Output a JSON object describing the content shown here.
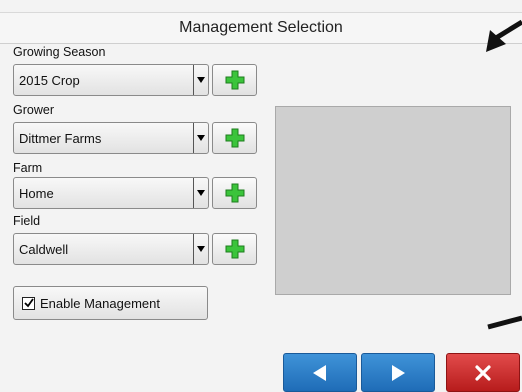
{
  "header": {
    "title": "Management Selection"
  },
  "fields": [
    {
      "label": "Growing Season",
      "value": "2015 Crop"
    },
    {
      "label": "Grower",
      "value": "Dittmer Farms"
    },
    {
      "label": "Farm",
      "value": "Home"
    },
    {
      "label": "Field",
      "value": "Caldwell"
    }
  ],
  "enable_management": {
    "label": "Enable Management",
    "checked": true
  },
  "icons": {
    "add": "plus-icon",
    "dropdown": "triangle-down-icon",
    "back": "arrow-left-icon",
    "forward": "arrow-right-icon",
    "cancel": "close-icon"
  },
  "colors": {
    "accent_blue": "#2a7cc7",
    "cancel_red": "#cc2b2b",
    "add_green": "#3bc43b"
  }
}
